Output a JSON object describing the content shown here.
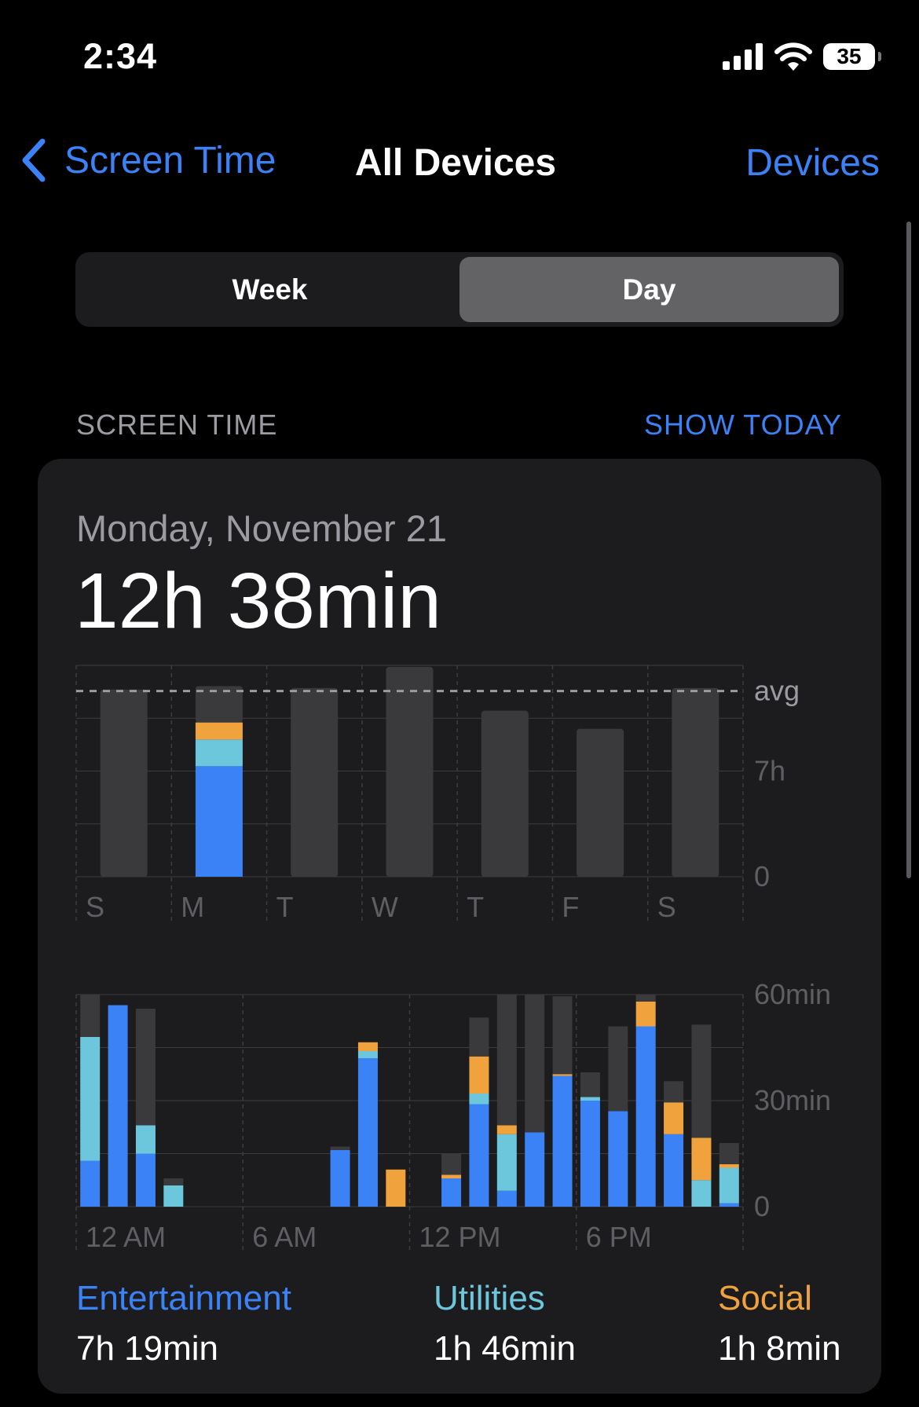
{
  "status_bar": {
    "time": "2:34",
    "battery": "35"
  },
  "nav": {
    "back_label": "Screen Time",
    "title": "All Devices",
    "right_label": "Devices"
  },
  "segment": {
    "options": [
      "Week",
      "Day"
    ],
    "selected": "Day"
  },
  "section": {
    "header": "SCREEN TIME",
    "action": "SHOW TODAY"
  },
  "card": {
    "date": "Monday, November 21",
    "total": "12h 38min"
  },
  "colors": {
    "entertainment": "#3b82f6",
    "utilities": "#6cc6dc",
    "social": "#f0a33c",
    "other": "#3a3a3c",
    "accent": "#3a82f6"
  },
  "chart_data": [
    {
      "type": "bar",
      "title": "",
      "categories": [
        "S",
        "M",
        "T",
        "W",
        "T",
        "F",
        "S"
      ],
      "y_tick_labels": [
        "avg",
        "7h",
        "0"
      ],
      "avg_label": "avg",
      "ylim_hours": [
        0,
        14
      ],
      "avg_hours": 12.3,
      "selected_index": 1,
      "series": [
        {
          "name": "Entertainment",
          "values": [
            0,
            7.32,
            0,
            0,
            0,
            0,
            0
          ]
        },
        {
          "name": "Utilities",
          "values": [
            0,
            1.77,
            0,
            0,
            0,
            0,
            0
          ]
        },
        {
          "name": "Social",
          "values": [
            0,
            1.13,
            0,
            0,
            0,
            0,
            0
          ]
        },
        {
          "name": "",
          "values": [
            12.4,
            2.41,
            12.5,
            13.9,
            11.0,
            9.8,
            12.5
          ]
        }
      ]
    },
    {
      "type": "bar",
      "title": "",
      "x_tick_labels": [
        "12 AM",
        "6 AM",
        "12 PM",
        "6 PM"
      ],
      "y_tick_labels": [
        "60min",
        "30min",
        "0"
      ],
      "ylim_minutes": [
        0,
        60
      ],
      "hours": [
        0,
        1,
        2,
        3,
        4,
        5,
        6,
        7,
        8,
        9,
        10,
        11,
        12,
        13,
        14,
        15,
        16,
        17,
        18,
        19,
        20,
        21,
        22,
        23
      ],
      "series": [
        {
          "name": "Entertainment",
          "values": [
            13,
            57,
            15,
            0,
            0,
            0,
            0,
            0,
            0,
            16,
            42,
            0,
            0,
            8,
            29,
            4.5,
            21,
            37,
            30,
            27,
            51,
            20.5,
            0,
            1
          ]
        },
        {
          "name": "Utilities",
          "values": [
            35,
            0,
            8,
            6,
            0,
            0,
            0,
            0,
            0,
            0,
            2,
            0,
            0,
            0,
            3,
            16,
            0,
            0,
            1,
            0,
            0,
            0,
            7.5,
            10
          ]
        },
        {
          "name": "Social",
          "values": [
            0,
            0,
            0,
            0,
            0,
            0,
            0,
            0,
            0,
            0,
            2.5,
            10.5,
            0,
            1,
            10.5,
            2.5,
            0,
            0.5,
            0,
            0,
            7,
            9,
            12,
            1
          ]
        },
        {
          "name": "",
          "values": [
            12,
            0,
            33,
            2,
            0,
            0,
            0,
            0,
            0,
            1,
            0,
            0,
            0,
            6,
            11,
            37,
            43,
            22,
            7,
            24,
            2,
            6,
            32,
            6
          ]
        }
      ]
    }
  ],
  "legend": [
    {
      "name": "Entertainment",
      "value": "7h 19min"
    },
    {
      "name": "Utilities",
      "value": "1h 46min"
    },
    {
      "name": "Social",
      "value": "1h 8min"
    }
  ]
}
